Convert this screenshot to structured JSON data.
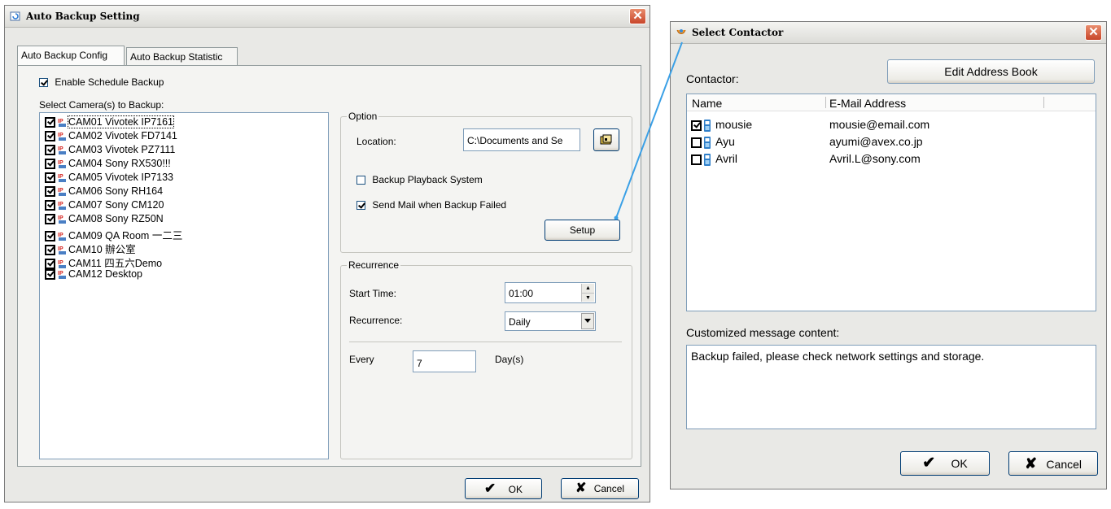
{
  "backup_dialog": {
    "title": "Auto Backup Setting",
    "tabs": [
      "Auto Backup Config",
      "Auto Backup Statistic"
    ],
    "enable_schedule_label": "Enable Schedule Backup",
    "enable_schedule_checked": true,
    "cameras_label": "Select Camera(s) to Backup:",
    "cameras": [
      {
        "name": "CAM01 Vivotek IP7161",
        "checked": true
      },
      {
        "name": "CAM02 Vivotek FD7141",
        "checked": true
      },
      {
        "name": "CAM03 Vivotek PZ7111",
        "checked": true
      },
      {
        "name": "CAM04 Sony RX530!!!",
        "checked": true
      },
      {
        "name": "CAM05 Vivotek IP7133",
        "checked": true
      },
      {
        "name": "CAM06 Sony RH164",
        "checked": true
      },
      {
        "name": "CAM07 Sony CM120",
        "checked": true
      },
      {
        "name": "CAM08 Sony RZ50N",
        "checked": true
      },
      {
        "name": "CAM09 QA Room 一二三",
        "checked": true
      },
      {
        "name": "CAM10 辦公室",
        "checked": true
      },
      {
        "name": "CAM11 四五六Demo",
        "checked": true
      },
      {
        "name": "CAM12 Desktop",
        "checked": true
      }
    ],
    "camera_icon_text": "IP",
    "option": {
      "legend": "Option",
      "location_label": "Location:",
      "location_value": "C:\\Documents and Se",
      "backup_playback_label": "Backup Playback System",
      "backup_playback_checked": false,
      "send_mail_label": "Send Mail when Backup Failed",
      "send_mail_checked": true,
      "setup_label": "Setup"
    },
    "recurrence": {
      "legend": "Recurrence",
      "start_time_label": "Start Time:",
      "start_time_value": "01:00",
      "recurrence_label": "Recurrence:",
      "recurrence_value": "Daily",
      "every_label": "Every",
      "every_value": "7",
      "unit_label": "Day(s)"
    },
    "ok_label": "OK",
    "cancel_label": "Cancel"
  },
  "contact_dialog": {
    "title": "Select Contactor",
    "contactor_label": "Contactor:",
    "edit_address_book_label": "Edit Address Book",
    "columns": [
      "Name",
      "E-Mail Address"
    ],
    "contacts": [
      {
        "name": "mousie",
        "email": "mousie@email.com",
        "checked": true
      },
      {
        "name": "Ayu",
        "email": "ayumi@avex.co.jp",
        "checked": false
      },
      {
        "name": "Avril",
        "email": "Avril.L@sony.com",
        "checked": false
      }
    ],
    "message_label": "Customized message content:",
    "message_text": "Backup failed, please check network settings and storage.",
    "ok_label": "OK",
    "cancel_label": "Cancel"
  },
  "colors": {
    "connector_line": "#3aa0e6",
    "window_bg": "#e9e9e6",
    "panel_bg": "#f4f4f2",
    "close_button": "#c8462a"
  }
}
